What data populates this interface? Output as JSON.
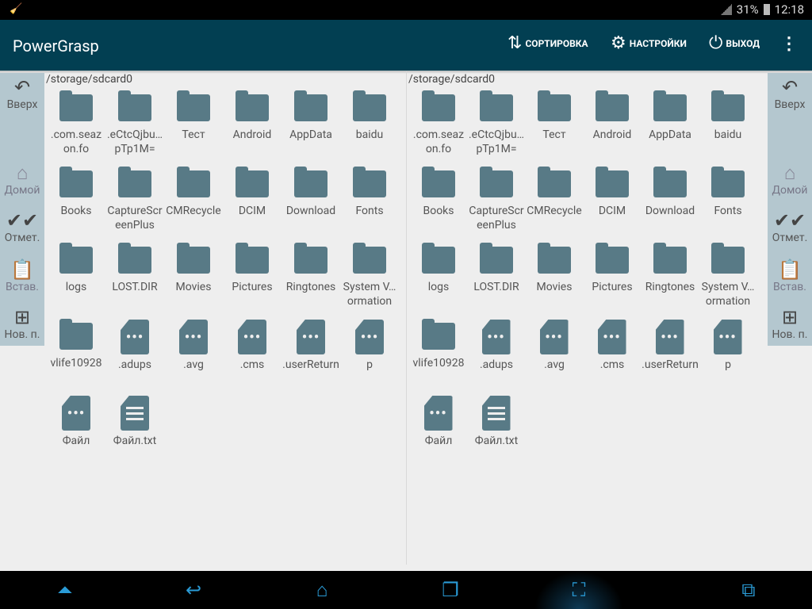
{
  "status": {
    "battery": "31%",
    "time": "12:18"
  },
  "appbar": {
    "title": "PowerGrasp",
    "sort": "СОРТИРОВКА",
    "settings": "НАСТРОЙКИ",
    "exit": "ВЫХОД"
  },
  "sidebar": {
    "up": "Вверх",
    "home": "Домой",
    "mark": "Отмет.",
    "paste": "Встав.",
    "new_folder": "Нов. п."
  },
  "panels": [
    {
      "path": "/storage/sdcard0",
      "items": [
        {
          "name": ".com.seazon.fo",
          "type": "folder"
        },
        {
          "name": ".eCtcQjbu…pTp1M=",
          "type": "folder"
        },
        {
          "name": "Тест",
          "type": "folder"
        },
        {
          "name": "Android",
          "type": "folder"
        },
        {
          "name": "AppData",
          "type": "folder"
        },
        {
          "name": "baidu",
          "type": "folder"
        },
        {
          "name": "Books",
          "type": "folder"
        },
        {
          "name": "CaptureScreenPlus",
          "type": "folder"
        },
        {
          "name": "CMRecycle",
          "type": "folder"
        },
        {
          "name": "DCIM",
          "type": "folder"
        },
        {
          "name": "Download",
          "type": "folder"
        },
        {
          "name": "Fonts",
          "type": "folder"
        },
        {
          "name": "logs",
          "type": "folder"
        },
        {
          "name": "LOST.DIR",
          "type": "folder"
        },
        {
          "name": "Movies",
          "type": "folder"
        },
        {
          "name": "Pictures",
          "type": "folder"
        },
        {
          "name": "Ringtones",
          "type": "folder"
        },
        {
          "name": "System V…ormation",
          "type": "folder"
        },
        {
          "name": "vlife10928",
          "type": "folder"
        },
        {
          "name": ".adups",
          "type": "file"
        },
        {
          "name": ".avg",
          "type": "file"
        },
        {
          "name": ".cms",
          "type": "file"
        },
        {
          "name": ".userReturn",
          "type": "file"
        },
        {
          "name": "p",
          "type": "file"
        },
        {
          "name": "Файл",
          "type": "file"
        },
        {
          "name": "Файл.txt",
          "type": "text"
        }
      ]
    },
    {
      "path": "/storage/sdcard0",
      "items": [
        {
          "name": ".com.seazon.fo",
          "type": "folder"
        },
        {
          "name": ".eCtcQjbu…pTp1M=",
          "type": "folder"
        },
        {
          "name": "Тест",
          "type": "folder"
        },
        {
          "name": "Android",
          "type": "folder"
        },
        {
          "name": "AppData",
          "type": "folder"
        },
        {
          "name": "baidu",
          "type": "folder"
        },
        {
          "name": "Books",
          "type": "folder"
        },
        {
          "name": "CaptureScreenPlus",
          "type": "folder"
        },
        {
          "name": "CMRecycle",
          "type": "folder"
        },
        {
          "name": "DCIM",
          "type": "folder"
        },
        {
          "name": "Download",
          "type": "folder"
        },
        {
          "name": "Fonts",
          "type": "folder"
        },
        {
          "name": "logs",
          "type": "folder"
        },
        {
          "name": "LOST.DIR",
          "type": "folder"
        },
        {
          "name": "Movies",
          "type": "folder"
        },
        {
          "name": "Pictures",
          "type": "folder"
        },
        {
          "name": "Ringtones",
          "type": "folder"
        },
        {
          "name": "System V…ormation",
          "type": "folder"
        },
        {
          "name": "vlife10928",
          "type": "folder"
        },
        {
          "name": ".adups",
          "type": "file"
        },
        {
          "name": ".avg",
          "type": "file"
        },
        {
          "name": ".cms",
          "type": "file"
        },
        {
          "name": ".userReturn",
          "type": "file"
        },
        {
          "name": "p",
          "type": "file"
        },
        {
          "name": "Файл",
          "type": "file"
        },
        {
          "name": "Файл.txt",
          "type": "text"
        }
      ]
    }
  ]
}
